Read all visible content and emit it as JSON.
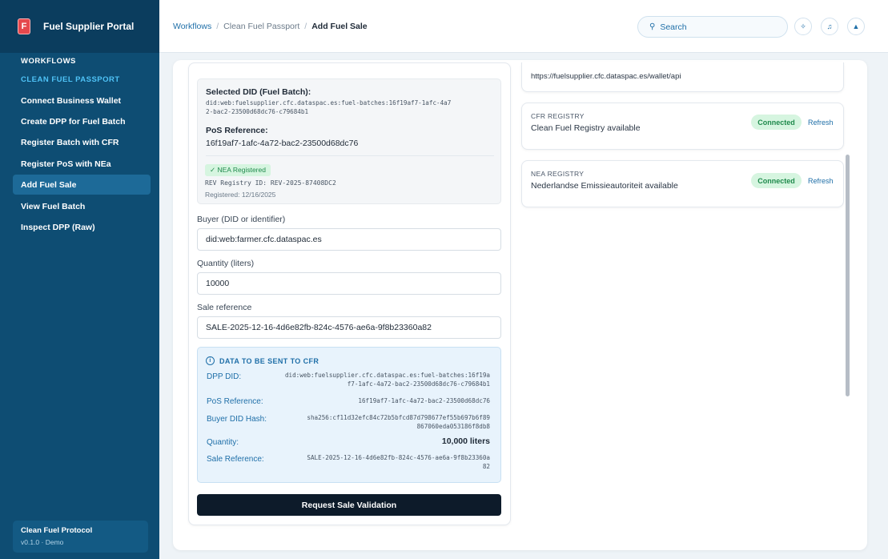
{
  "app": {
    "title": "Fuel Supplier Portal",
    "logo_glyph": "F"
  },
  "sidebar": {
    "section1": "WORKFLOWS",
    "section2": "CLEAN FUEL PASSPORT",
    "items": [
      {
        "label": "Connect Business Wallet"
      },
      {
        "label": "Create DPP for Fuel Batch"
      },
      {
        "label": "Register Batch with CFR"
      },
      {
        "label": "Register PoS with NEa"
      },
      {
        "label": "Add Fuel Sale"
      },
      {
        "label": "View Fuel Batch"
      },
      {
        "label": "Inspect DPP (Raw)"
      }
    ],
    "active_index": 4,
    "footer": {
      "title": "Clean Fuel Protocol",
      "version": "v0.1.0 · Demo"
    }
  },
  "header": {
    "breadcrumb": [
      "Workflows",
      "Clean Fuel Passport",
      "Add Fuel Sale"
    ],
    "breadcrumb_sep": "/",
    "search_placeholder": "Search",
    "search_icon": "search-icon",
    "buttons": [
      {
        "icon": "sun-icon",
        "glyph": "✧"
      },
      {
        "icon": "bell-icon",
        "glyph": "♫"
      },
      {
        "icon": "user-icon",
        "glyph": "▲"
      }
    ]
  },
  "form": {
    "selected_did_label": "Selected DID (Fuel Batch):",
    "selected_did_line1": "did:web:fuelsupplier.cfc.dataspac.es:fuel-batches:16f19af7-1afc-4a7",
    "selected_did_line2": "2-bac2-23500d68dc76-c79684b1",
    "pos_ref_label": "PoS Reference:",
    "pos_ref_value": "16f19af7-1afc-4a72-bac2-23500d68dc76",
    "nea_badge": "✓ NEA Registered",
    "rev_registry": "REV Registry ID: REV-2025-87408DC2",
    "registered": "Registered: 12/16/2025",
    "buyer_label": "Buyer (DID or identifier)",
    "buyer_value": "did:web:farmer.cfc.dataspac.es",
    "quantity_label": "Quantity (liters)",
    "quantity_value": "10000",
    "sale_ref_label": "Sale reference",
    "sale_ref_value": "SALE-2025-12-16-4d6e82fb-824c-4576-ae6a-9f8b23360a82",
    "cfr_heading": "DATA TO BE SENT TO CFR",
    "cfr_info_glyph": "i",
    "cfr_rows": {
      "dpp_did_key": "DPP DID:",
      "dpp_did_line1": "did:web:fuelsupplier.cfc.dataspac.es:fuel-batches:16f19a",
      "dpp_did_line2": "f7-1afc-4a72-bac2-23500d68dc76-c79684b1",
      "pos_key": "PoS Reference:",
      "pos_val": "16f19af7-1afc-4a72-bac2-23500d68dc76",
      "buyer_hash_key": "Buyer DID Hash:",
      "buyer_hash_line1": "sha256:cf11d32efc84c72b5bfcd87d798677ef55b697b6f89",
      "buyer_hash_line2": "867060eda053186f8db8",
      "quantity_key": "Quantity:",
      "quantity_val": "10,000 liters",
      "sale_ref_key": "Sale Reference:",
      "sale_ref_line1": "SALE-2025-12-16-4d6e82fb-824c-4576-ae6a-9f8b23360a",
      "sale_ref_line2": "82"
    },
    "submit_label": "Request Sale Validation"
  },
  "registries": {
    "wallet_url": "https://fuelsupplier.cfc.dataspac.es/wallet/api",
    "cfr": {
      "title": "CFR REGISTRY",
      "desc": "Clean Fuel Registry available",
      "status": "Connected",
      "refresh": "Refresh"
    },
    "nea": {
      "title": "NEA REGISTRY",
      "desc": "Nederlandse Emissieautoriteit available",
      "status": "Connected",
      "refresh": "Refresh"
    }
  },
  "colors": {
    "sidebar": "#0e4d73",
    "accent": "#1f6fa8",
    "success": "#1f8a4c",
    "button_dark": "#0d1b2a"
  }
}
